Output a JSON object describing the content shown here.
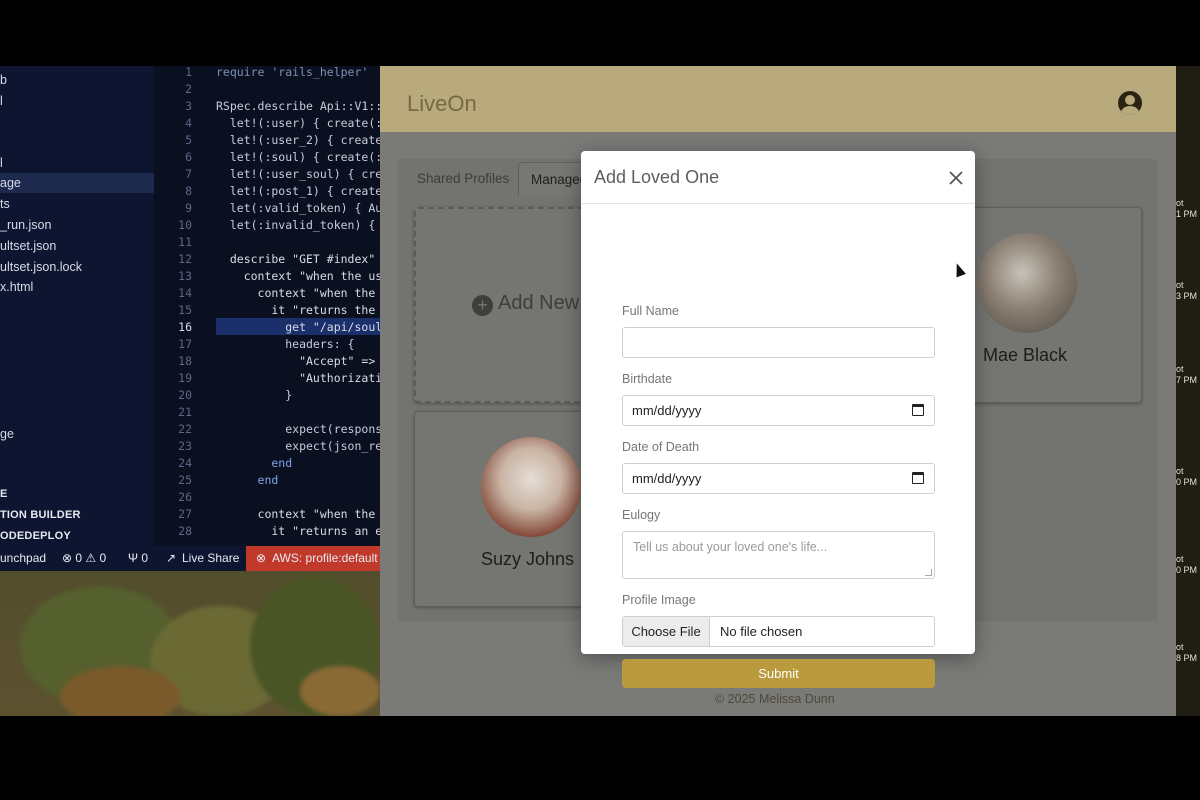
{
  "vscode": {
    "explorer_items": [
      {
        "label": "b",
        "selected": false
      },
      {
        "label": "l",
        "selected": false
      },
      {
        "label": "l",
        "selected": false
      },
      {
        "label": "age",
        "selected": true
      },
      {
        "label": "ts",
        "selected": false
      },
      {
        "label": "_run.json",
        "selected": false
      },
      {
        "label": "ultset.json",
        "selected": false
      },
      {
        "label": "ultset.json.lock",
        "selected": false
      },
      {
        "label": "x.html",
        "selected": false
      },
      {
        "label": "ge",
        "selected": false
      }
    ],
    "sections": [
      "E",
      "TION BUILDER",
      "ODEDEPLOY"
    ],
    "line_numbers": [
      "1",
      "2",
      "3",
      "4",
      "5",
      "6",
      "7",
      "8",
      "9",
      "10",
      "11",
      "12",
      "13",
      "14",
      "15",
      "16",
      "17",
      "18",
      "19",
      "20",
      "21",
      "22",
      "23",
      "24",
      "25",
      "26",
      "27",
      "28"
    ],
    "current_line": "16",
    "code_lines": [
      "require 'rails_helper'",
      "",
      "RSpec.describe Api::V1::",
      "  let!(:user) { create(:",
      "  let!(:user_2) { create",
      "  let!(:soul) { create(:",
      "  let!(:user_soul) { cre",
      "  let!(:post_1) { create",
      "  let(:valid_token) { Au",
      "  let(:invalid_token) {",
      "",
      "  describe \"GET #index\"",
      "    context \"when the us",
      "      context \"when the",
      "        it \"returns the",
      "          get \"/api/soul",
      "          headers: {",
      "            \"Accept\" =>",
      "            \"Authorizati",
      "          }",
      "",
      "          expect(respons",
      "          expect(json_re",
      "        end",
      "      end",
      "",
      "      context \"when the",
      "        it \"returns an e"
    ],
    "status": {
      "launchpad": "unchpad",
      "problems": "⊗ 0 ⚠ 0",
      "ports": "Ψ 0",
      "live_share": "Live Share",
      "aws": "AWS: profile:default"
    }
  },
  "app": {
    "brand": "LiveOn",
    "tabs": [
      "Shared Profiles",
      "Managed"
    ],
    "active_tab": "Managed",
    "add_new_label": "Add New",
    "profiles": [
      {
        "name": "Mae Black"
      },
      {
        "name": "Suzy Johns"
      }
    ],
    "footer": "© 2025 Melissa Dunn"
  },
  "modal": {
    "title": "Add Loved One",
    "close_icon": "close-icon",
    "fields": {
      "full_name_label": "Full Name",
      "full_name_value": "",
      "birthdate_label": "Birthdate",
      "birthdate_value": "mm/dd/yyyy",
      "death_label": "Date of Death",
      "death_value": "mm/dd/yyyy",
      "eulogy_label": "Eulogy",
      "eulogy_placeholder": "Tell us about your loved one's life...",
      "image_label": "Profile Image",
      "choose_file": "Choose File",
      "no_file": "No file chosen"
    },
    "submit_label": "Submit"
  },
  "right_strip": [
    "ot",
    "1 PM",
    "ot",
    "3 PM",
    "ot",
    "7 PM",
    "ot",
    "0 PM",
    "ot",
    "0 PM",
    "ot",
    "8 PM"
  ],
  "colors": {
    "accent": "#b99a3c",
    "brand_text": "#786a3e",
    "aws_status": "#c0392b"
  }
}
